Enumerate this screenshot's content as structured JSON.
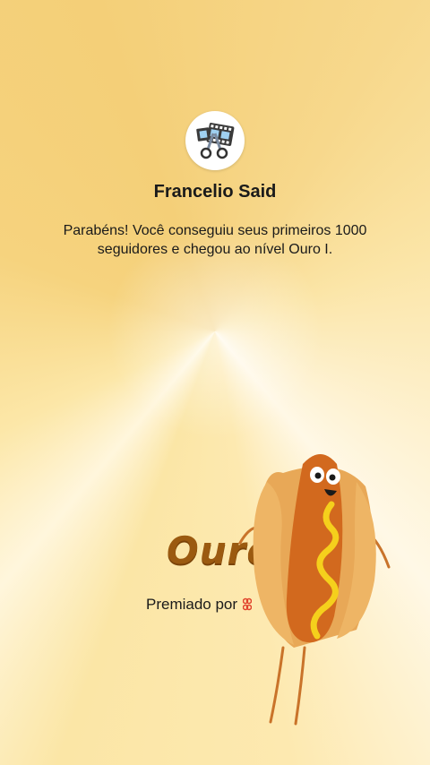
{
  "profile": {
    "name": "Francelio Said",
    "avatar_icon": "film-scissors-icon"
  },
  "message": "Parabéns! Você conseguiu seus primeiros 1000 seguidores e chegou ao nível Ouro I.",
  "badge": {
    "level_label": "Ouro",
    "awarded_by_label": "Premiado por",
    "sponsor_icon": "brand-logo-icon",
    "mascot_icon": "hotdog-mascot-icon"
  },
  "colors": {
    "background": "#f7d98a",
    "level_text": "#9b5a10",
    "sponsor": "#e0402a"
  }
}
